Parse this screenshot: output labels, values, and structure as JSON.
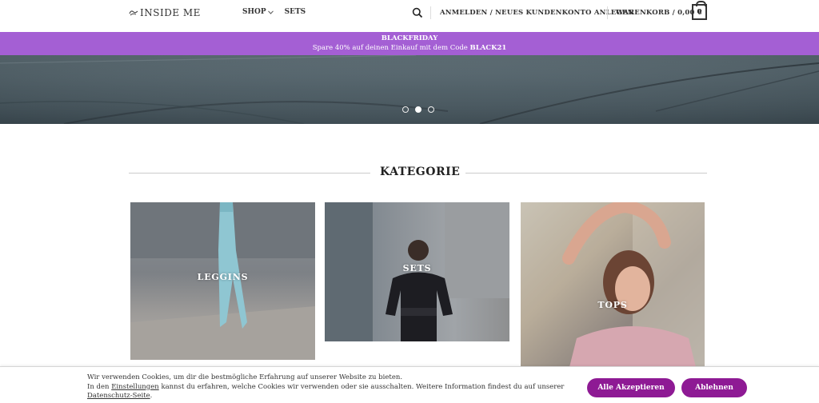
{
  "header": {
    "logo_text": "INSIDE ME",
    "nav": [
      {
        "label": "SHOP"
      },
      {
        "label": "SETS"
      }
    ],
    "account_label": "ANMELDEN / NEUES KUNDENKONTO ANLEGEN",
    "cart_label": "WARENKORB / 0,00 €",
    "cart_count": "0"
  },
  "promo": {
    "title": "BLACKFRIDAY",
    "text": "Spare 40% auf deinen Einkauf mit dem Code",
    "code": "BLACK21"
  },
  "slider": {
    "active_index": 1,
    "count": 3
  },
  "categories": {
    "title": "KATEGORIE",
    "items": [
      {
        "label": "LEGGINS"
      },
      {
        "label": "SETS"
      },
      {
        "label": "TOPS"
      }
    ]
  },
  "cookie": {
    "line1": "Wir verwenden Cookies, um dir die bestmögliche Erfahrung auf unserer Website zu bieten.",
    "line2_prefix": "In den",
    "settings_link": "Einstellungen",
    "line2_suffix": "kannst du erfahren, welche Cookies wir verwenden oder sie ausschalten. Weitere Information findest du auf unserer",
    "privacy_link": "Datenschutz-Seite",
    "accept_label": "Alle Akzeptieren",
    "reject_label": "Ablehnen"
  },
  "colors": {
    "promo_bg": "#a45fd4",
    "button_bg": "#8e1a94"
  }
}
